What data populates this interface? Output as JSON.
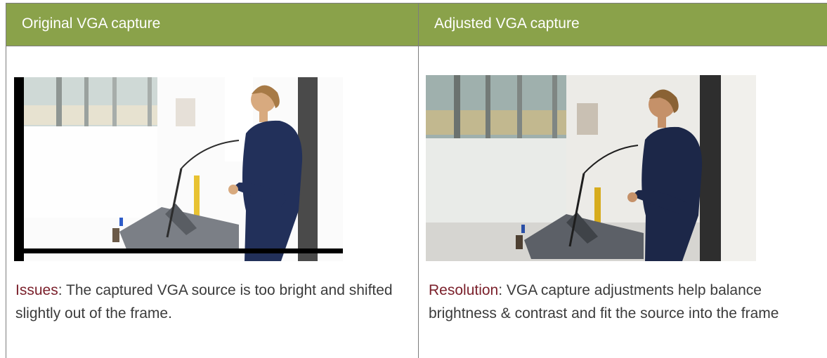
{
  "table": {
    "columns": [
      {
        "header": "Original VGA capture",
        "image_description_name": "speaker-at-podium-original-photo",
        "caption_label": "Issues",
        "caption_text": ": The captured VGA source is too bright and shifted slightly out of the frame."
      },
      {
        "header": "Adjusted VGA capture",
        "image_description_name": "speaker-at-podium-adjusted-photo",
        "caption_label": "Resolution",
        "caption_text": ": VGA capture adjustments help balance brightness & contrast and fit the source into the frame"
      }
    ]
  },
  "colors": {
    "header_bg": "#8aa24a",
    "header_text": "#ffffff",
    "label_color": "#7a1f2a",
    "body_text": "#3b3b3b",
    "dress": "#22305a"
  }
}
